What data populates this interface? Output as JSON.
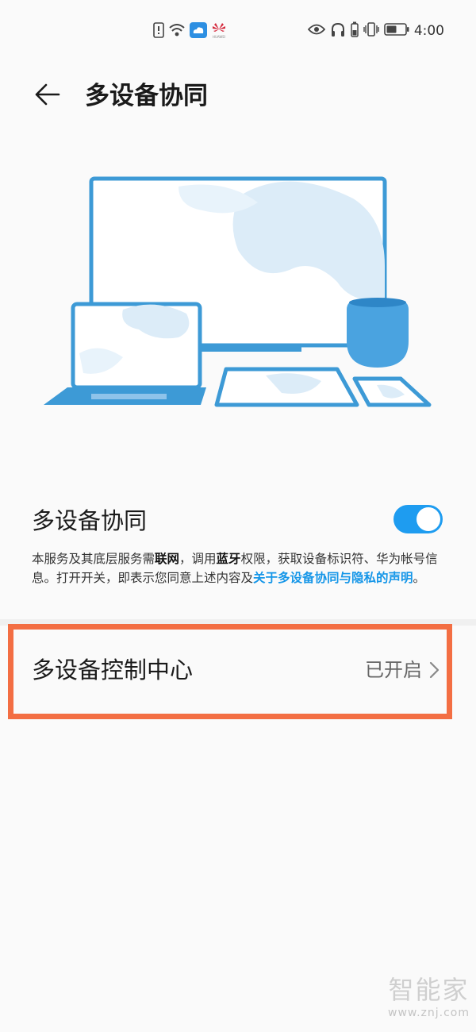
{
  "status_bar": {
    "time": "4:00",
    "brand_mark": "HUAWEI",
    "left_icons": [
      "alert-icon",
      "wifi-icon",
      "cloud-icon",
      "huawei-logo-icon"
    ],
    "right_icons": [
      "eye-icon",
      "headphones-icon",
      "battery-small-icon",
      "vibrate-icon",
      "battery-icon"
    ]
  },
  "header": {
    "title": "多设备协同",
    "back_icon": "back-arrow-icon"
  },
  "illustration": {
    "accent": "#3d9ad6",
    "fill": "#e3f1fb",
    "devices": [
      "monitor",
      "laptop",
      "tablet",
      "phone",
      "smart-speaker"
    ]
  },
  "toggle_row": {
    "label": "多设备协同",
    "enabled": true,
    "color": "#1e9cf0"
  },
  "description": {
    "part1": "本服务及其底层服务需",
    "bold1": "联网",
    "part2": "，调用",
    "bold2": "蓝牙",
    "part3": "权限，获取设备标识符、华为帐号信息。打开开关，即表示您同意上述内容及",
    "link": "关于多设备协同与隐私的声明",
    "part4": "。"
  },
  "control_center": {
    "label": "多设备控制中心",
    "status": "已开启",
    "highlight_color": "#f36e43"
  },
  "watermark": {
    "main": "智能家",
    "sub": "www.znj.com"
  }
}
